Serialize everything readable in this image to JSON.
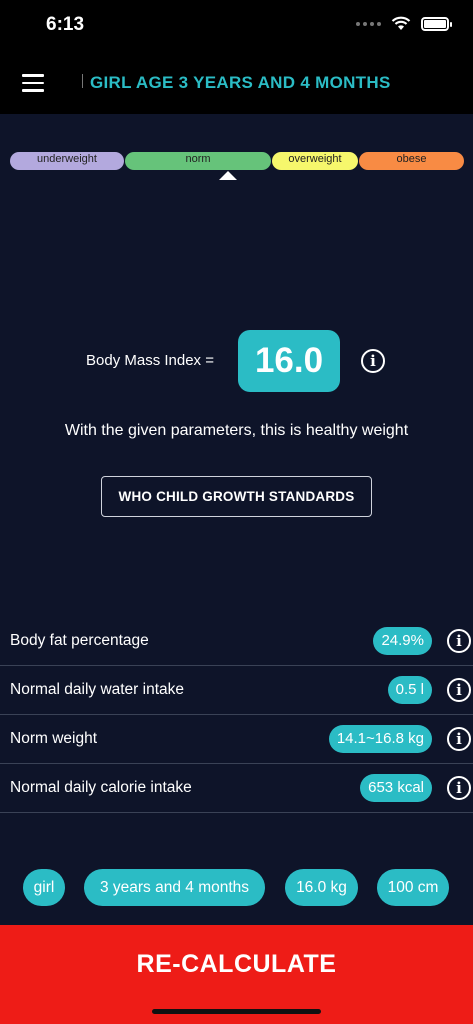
{
  "status_bar": {
    "time": "6:13"
  },
  "header": {
    "title": "GIRL AGE 3 YEARS AND 4 MONTHS"
  },
  "bmi_scale": {
    "segments": [
      {
        "label": "underweight",
        "color": "#b3a9de"
      },
      {
        "label": "norm",
        "color": "#66c37a"
      },
      {
        "label": "overweight",
        "color": "#f6f76c"
      },
      {
        "label": "obese",
        "color": "#f88b44"
      }
    ]
  },
  "bmi": {
    "label": "Body Mass Index =",
    "value": "16.0",
    "info_symbol": "i"
  },
  "result": {
    "text": "With the given parameters, this is healthy weight",
    "standards_button": "WHO CHILD GROWTH STANDARDS"
  },
  "metrics": [
    {
      "label": "Body fat percentage",
      "value": "24.9%"
    },
    {
      "label": "Normal daily water intake",
      "value": "0.5 l"
    },
    {
      "label": "Norm weight",
      "value": "14.1~16.8 kg"
    },
    {
      "label": "Normal daily calorie intake",
      "value": "653 kcal"
    }
  ],
  "chips": [
    "girl",
    "3 years and 4 months",
    "16.0 kg",
    "100 cm"
  ],
  "recalculate_label": "RE-CALCULATE",
  "colors": {
    "accent": "#2bbcc5",
    "background": "#0e1429",
    "action": "#ee1c17"
  }
}
